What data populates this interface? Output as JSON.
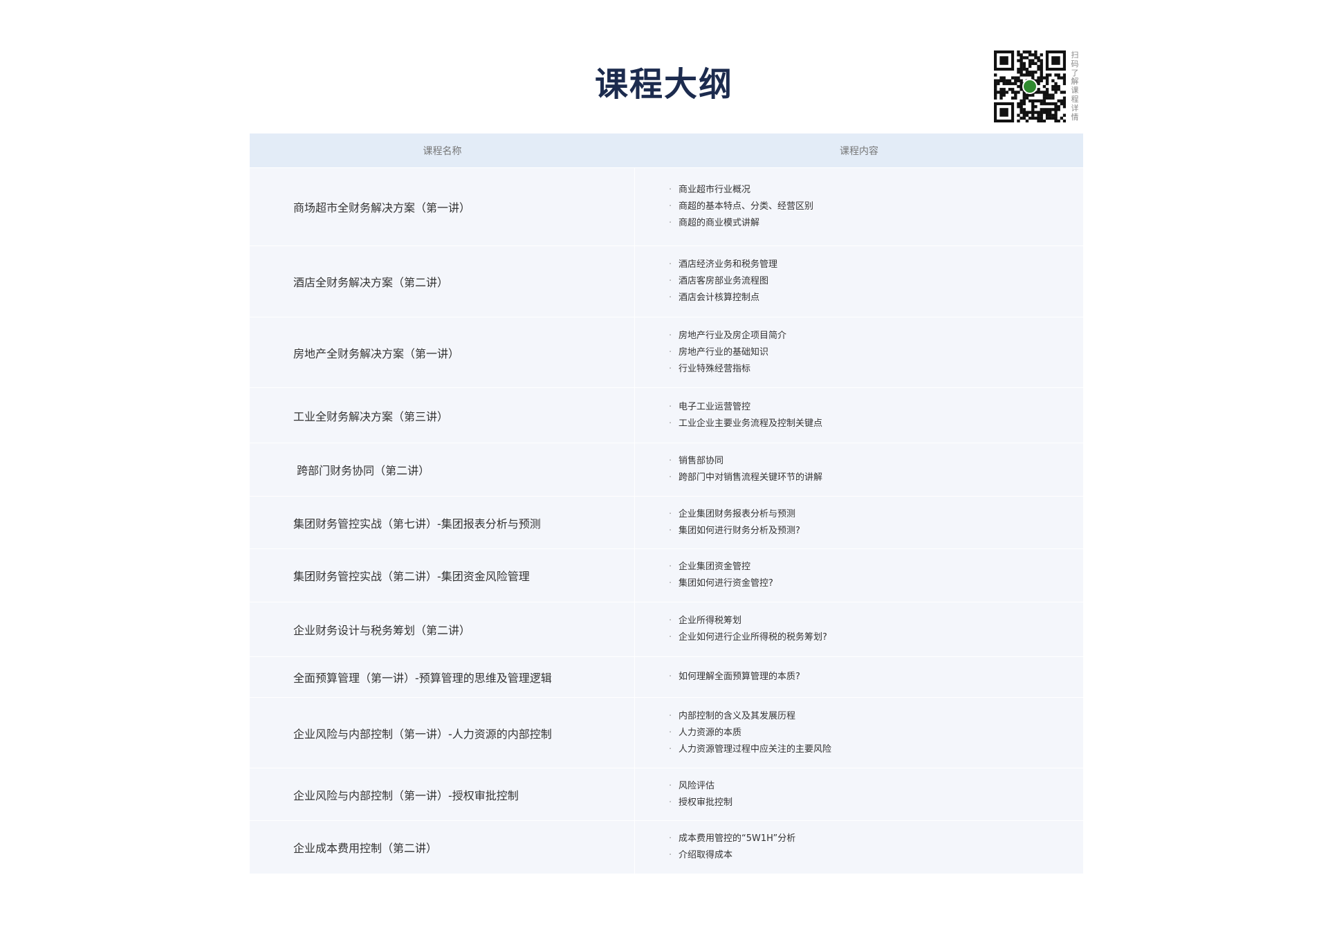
{
  "title": "课程大纲",
  "qr_caption": "扫码了解课程详情",
  "table": {
    "headers": [
      "课程名称",
      "课程内容"
    ],
    "rows": [
      {
        "name": "商场超市全财务解决方案（第一讲）",
        "topics": [
          "商业超市行业概况",
          "商超的基本特点、分类、经营区别",
          "商超的商业模式讲解"
        ]
      },
      {
        "name": "酒店全财务解决方案（第二讲）",
        "topics": [
          "酒店经济业务和税务管理",
          "酒店客房部业务流程图",
          "酒店会计核算控制点"
        ]
      },
      {
        "name": "房地产全财务解决方案（第一讲）",
        "topics": [
          "房地产行业及房企项目简介",
          "房地产行业的基础知识",
          "行业特殊经营指标"
        ]
      },
      {
        "name": "工业全财务解决方案（第三讲）",
        "topics": [
          "电子工业运营管控",
          "工业企业主要业务流程及控制关键点"
        ]
      },
      {
        "name": " 跨部门财务协同（第二讲）",
        "topics": [
          "销售部协同",
          "跨部门中对销售流程关键环节的讲解"
        ]
      },
      {
        "name": "集团财务管控实战（第七讲）-集团报表分析与预测",
        "topics": [
          "企业集团财务报表分析与预测",
          "集团如何进行财务分析及预测?"
        ]
      },
      {
        "name": "集团财务管控实战（第二讲）-集团资金风险管理",
        "topics": [
          "企业集团资金管控",
          "集团如何进行资金管控?"
        ]
      },
      {
        "name": "企业财务设计与税务筹划（第二讲）",
        "topics": [
          "企业所得税筹划",
          "企业如何进行企业所得税的税务筹划?"
        ]
      },
      {
        "name": "全面预算管理（第一讲）-预算管理的思维及管理逻辑",
        "topics": [
          "如何理解全面预算管理的本质?"
        ]
      },
      {
        "name": "企业风险与内部控制（第一讲）-人力资源的内部控制",
        "topics": [
          "内部控制的含义及其发展历程",
          "人力资源的本质",
          "人力资源管理过程中应关注的主要风险"
        ]
      },
      {
        "name": "企业风险与内部控制（第一讲）-授权审批控制",
        "topics": [
          "风险评估",
          "授权审批控制"
        ]
      },
      {
        "name": "企业成本费用控制（第二讲）",
        "topics": [
          "成本费用管控的“5W1H”分析",
          "介绍取得成本"
        ]
      }
    ]
  }
}
